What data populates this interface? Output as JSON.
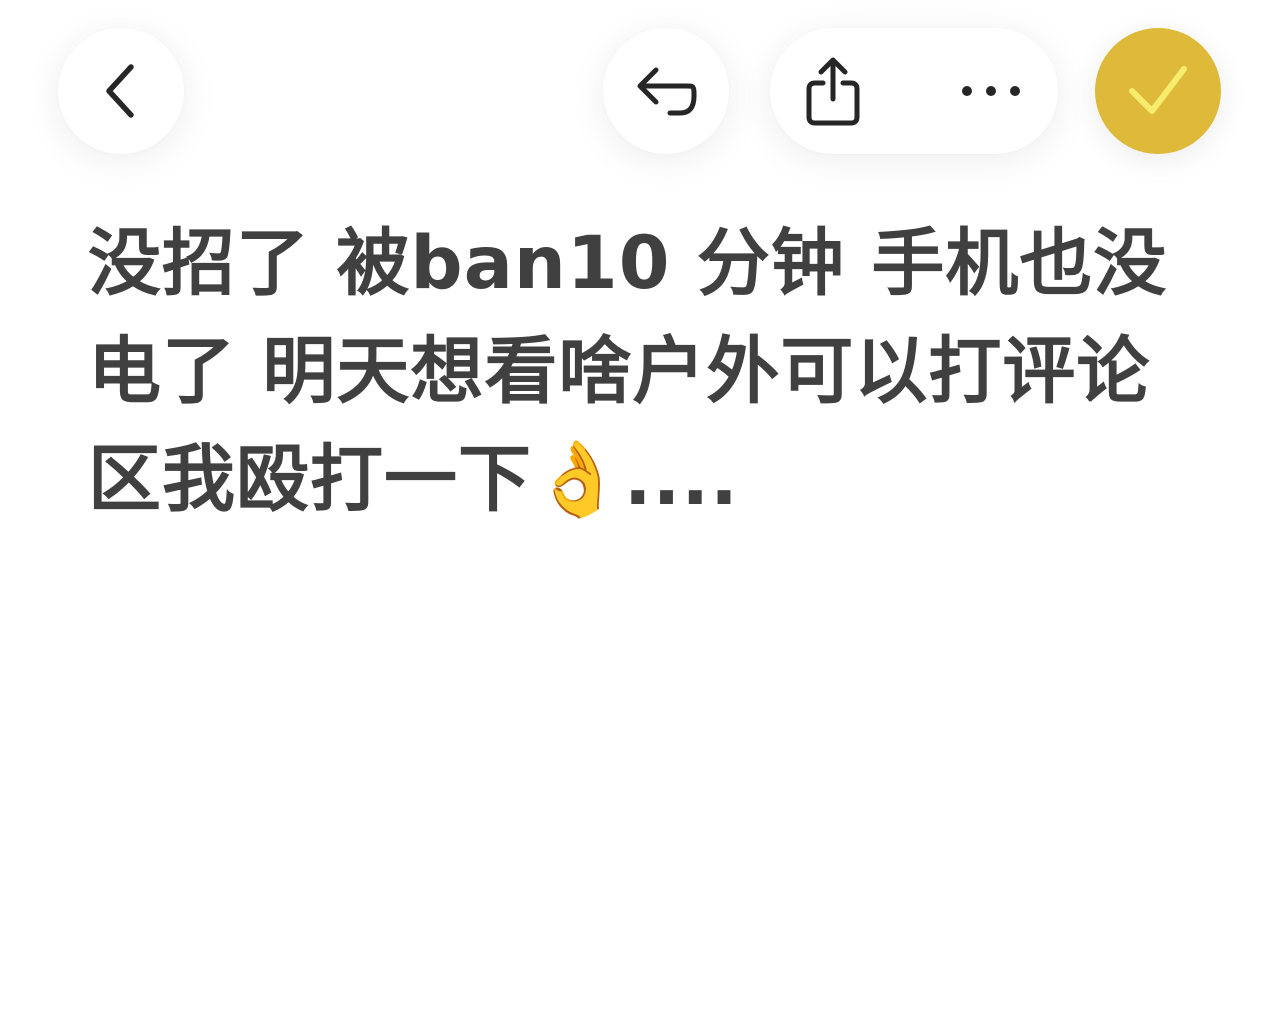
{
  "toolbar": {
    "back_icon": "chevron-left-icon",
    "undo_icon": "undo-icon",
    "share_icon": "share-icon",
    "more_icon": "more-horizontal-icon",
    "done_icon": "checkmark-icon",
    "accent_color": "#dfb93a",
    "check_color": "#f6ec6e"
  },
  "note": {
    "text": "没招了 被ban10 分钟 手机也没电了 明天想看啥户外可以打评论区我殴打一下👌...."
  }
}
